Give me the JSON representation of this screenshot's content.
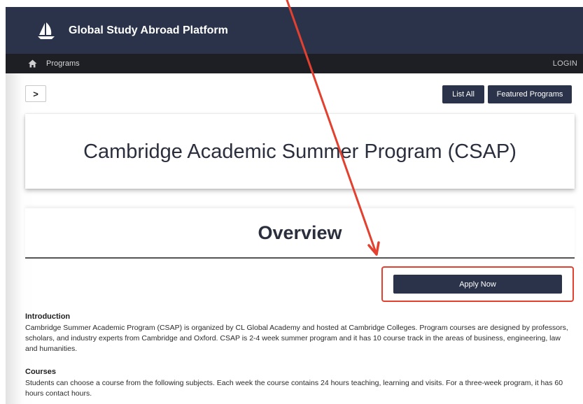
{
  "header": {
    "brand_title": "Global Study Abroad Platform",
    "logo_icon": "sailboat-icon"
  },
  "navbar": {
    "home_icon": "home-icon",
    "programs_label": "Programs",
    "login_label": "LOGIN"
  },
  "toolbar": {
    "toggle_label": ">",
    "list_all_label": "List All",
    "featured_label": "Featured Programs"
  },
  "program": {
    "title": "Cambridge Academic Summer Program (CSAP)"
  },
  "overview": {
    "title": "Overview",
    "apply_label": "Apply Now"
  },
  "sections": {
    "introduction": {
      "heading": "Introduction",
      "body": "Cambridge Summer Academic Program (CSAP) is organized by CL Global Academy and hosted at Cambridge Colleges. Program courses are designed by professors, scholars, and industry experts from Cambridge and Oxford. CSAP is 2-4 week summer program and it has 10 course track in the areas of business, engineering, law and humanities."
    },
    "courses": {
      "heading": "Courses",
      "body": "Students can choose a course from the following subjects. Each week the course contains 24 hours teaching, learning and visits. For a three-week program, it has 60 hours contact hours."
    }
  },
  "colors": {
    "brand_navy": "#2a3349",
    "navbar_black": "#1d1f24",
    "annotation_red": "#e3402f"
  }
}
